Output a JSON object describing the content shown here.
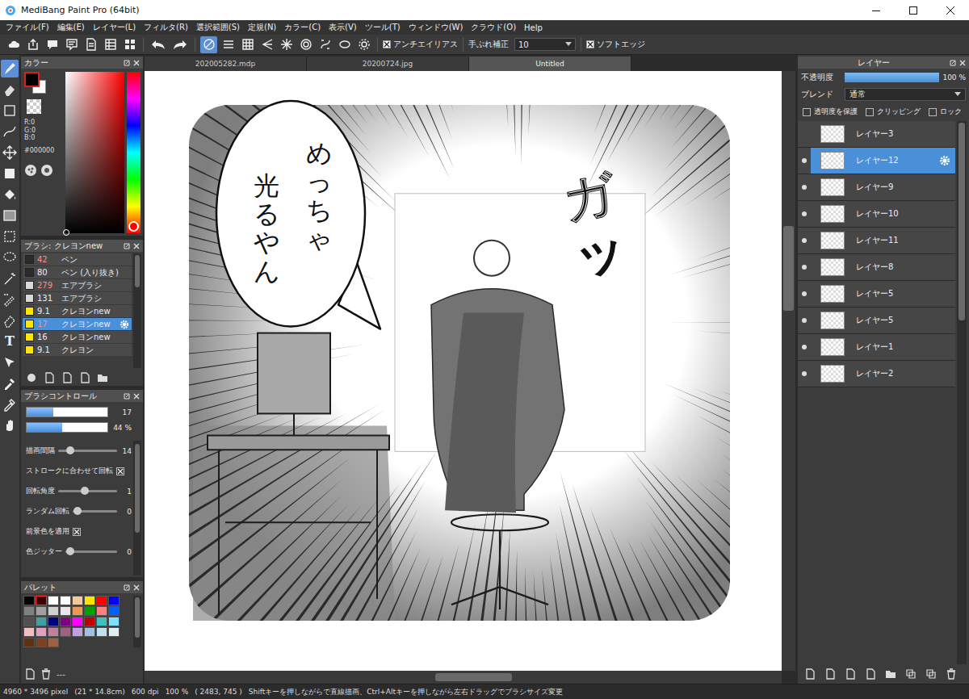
{
  "window": {
    "title": "MediBang Paint Pro (64bit)"
  },
  "menu": [
    "ファイル(F)",
    "編集(E)",
    "レイヤー(L)",
    "フィルタ(R)",
    "選択範囲(S)",
    "定規(N)",
    "カラー(C)",
    "表示(V)",
    "ツール(T)",
    "ウィンドウ(W)",
    "クラウド(O)",
    "Help"
  ],
  "toolbar": {
    "ruler_modes": [
      {
        "selected": true
      },
      {
        "selected": false
      },
      {
        "selected": false
      },
      {
        "selected": false
      },
      {
        "selected": false
      },
      {
        "selected": false
      },
      {
        "selected": false
      },
      {
        "selected": false
      },
      {
        "selected": false
      }
    ],
    "antialias": {
      "label": "アンチエイリアス",
      "checked": true
    },
    "stabilizer": {
      "label": "手ぶれ補正",
      "value": "10"
    },
    "soft_edge": {
      "label": "ソフトエッジ",
      "checked": true
    }
  },
  "tools": [
    {
      "kind": "brush",
      "selected": true
    },
    {
      "kind": "eraser",
      "selected": false
    },
    {
      "kind": "shape",
      "selected": false
    },
    {
      "kind": "curve",
      "selected": false
    },
    {
      "kind": "move",
      "selected": false
    },
    {
      "kind": "fill-rect",
      "selected": false
    },
    {
      "kind": "bucket",
      "selected": false
    },
    {
      "kind": "gradient",
      "selected": false
    },
    {
      "kind": "select",
      "selected": false
    },
    {
      "kind": "lasso",
      "selected": false
    },
    {
      "kind": "wand",
      "selected": false
    },
    {
      "kind": "select-pen",
      "selected": false
    },
    {
      "kind": "select-eraser",
      "selected": false
    },
    {
      "kind": "text",
      "glyph": "T",
      "selected": false
    },
    {
      "kind": "operation",
      "selected": false
    },
    {
      "kind": "dropper",
      "selected": false
    },
    {
      "kind": "dropper2",
      "selected": false
    },
    {
      "kind": "hand",
      "selected": false
    }
  ],
  "color_panel": {
    "title": "カラー",
    "foreground": "#000000",
    "r": "R:0",
    "g": "G:0",
    "b": "B:0",
    "hex": "#000000"
  },
  "brush_panel": {
    "title": "ブラシ: クレヨンnew",
    "items": [
      {
        "size": "42",
        "name": "ペン",
        "color": "#2b2b2b",
        "highlight": true,
        "selected": false
      },
      {
        "size": "80",
        "name": "ペン (入り抜き)",
        "color": "#2b2b2b",
        "highlight": false,
        "selected": false
      },
      {
        "size": "279",
        "name": "エアブラシ",
        "color": "#d9d9d9",
        "highlight": true,
        "selected": false
      },
      {
        "size": "131",
        "name": "エアブラシ",
        "color": "#d9d9d9",
        "highlight": false,
        "selected": false
      },
      {
        "size": "9.1",
        "name": "クレヨンnew",
        "color": "#ffe600",
        "highlight": false,
        "selected": false
      },
      {
        "size": "17",
        "name": "クレヨンnew",
        "color": "#ffe600",
        "highlight": true,
        "selected": true
      },
      {
        "size": "16",
        "name": "クレヨンnew",
        "color": "#ffe600",
        "highlight": false,
        "selected": false
      },
      {
        "size": "9.1",
        "name": "クレヨン",
        "color": "#ffe600",
        "highlight": false,
        "selected": false
      }
    ]
  },
  "brush_control": {
    "title": "ブラシコントロール",
    "size": {
      "value": "17",
      "level": 0.33
    },
    "opacity": {
      "value": "44 %",
      "level": 0.44
    },
    "settings": [
      {
        "kind": "slider",
        "label": "描画間隔",
        "level": 0.2
      },
      {
        "kind": "check",
        "label": "ストロークに合わせて回転",
        "checked": true
      },
      {
        "kind": "slider",
        "label": "回転角度",
        "level": 0.45
      },
      {
        "kind": "slider",
        "label": "ランダム回転",
        "level": 0.1
      },
      {
        "kind": "check",
        "label": "前景色を適用",
        "checked": true
      },
      {
        "kind": "slider",
        "label": "色ジッター",
        "level": 0.1
      }
    ],
    "values": [
      "14",
      "1",
      "0",
      "0"
    ]
  },
  "palette": {
    "title": "パレット",
    "footer": "---",
    "swatches": [
      {
        "color": "#000000",
        "selected": false
      },
      {
        "color": "#3a0000",
        "selected": true
      },
      {
        "color": "#ffffff",
        "selected": false
      },
      {
        "color": "#ffffff",
        "selected": false
      },
      {
        "color": "#f3c89a",
        "selected": false
      },
      {
        "color": "#ffe400",
        "selected": false
      },
      {
        "color": "#ff0000",
        "selected": false
      },
      {
        "color": "#0000ff",
        "selected": false
      },
      {
        "color": "#808080",
        "selected": false
      },
      {
        "color": "#a0a0a0",
        "selected": false
      },
      {
        "color": "#d0d0d0",
        "selected": false
      },
      {
        "color": "#e8e8e8",
        "selected": false
      },
      {
        "color": "#e89a5a",
        "selected": false
      },
      {
        "color": "#00a000",
        "selected": false
      },
      {
        "color": "#ff8080",
        "selected": false
      },
      {
        "color": "#0060ff",
        "selected": false
      },
      {
        "color": "#505050",
        "selected": false
      },
      {
        "color": "#40a0a0",
        "selected": false
      },
      {
        "color": "#000080",
        "selected": false
      },
      {
        "color": "#800080",
        "selected": false
      },
      {
        "color": "#ff00ff",
        "selected": false
      },
      {
        "color": "#c00000",
        "selected": false
      },
      {
        "color": "#40c0c0",
        "selected": false
      },
      {
        "color": "#80e0ff",
        "selected": false
      },
      {
        "color": "#f0c0c0",
        "selected": false
      },
      {
        "color": "#e0a0c0",
        "selected": false
      },
      {
        "color": "#c080a0",
        "selected": false
      },
      {
        "color": "#a06080",
        "selected": false
      },
      {
        "color": "#c0a0e0",
        "selected": false
      },
      {
        "color": "#a0c0e0",
        "selected": false
      },
      {
        "color": "#c0e0f0",
        "selected": false
      },
      {
        "color": "#e0f0f0",
        "selected": false
      },
      {
        "color": "#603010",
        "selected": false
      },
      {
        "color": "#804020",
        "selected": false
      },
      {
        "color": "#a06040",
        "selected": false
      }
    ]
  },
  "tabs": [
    {
      "label": "202005282.mdp",
      "selected": false
    },
    {
      "label": "20200724.jpg",
      "selected": false
    },
    {
      "label": "Untitled",
      "selected": true
    }
  ],
  "canvas": {
    "bubble": [
      "めっちゃ",
      "光るやん"
    ],
    "sfx": "ガッ"
  },
  "layers_panel": {
    "title": "レイヤー",
    "opacity": {
      "label": "不透明度",
      "value": "100 %",
      "level": 1
    },
    "blend": {
      "label": "ブレンド",
      "value": "通常"
    },
    "options": [
      {
        "label": "透明度を保護",
        "checked": false
      },
      {
        "label": "クリッピング",
        "checked": false
      },
      {
        "label": "ロック",
        "checked": false
      }
    ],
    "layers": [
      {
        "name": "レイヤー3",
        "visible": false,
        "selected": false
      },
      {
        "name": "レイヤー12",
        "visible": true,
        "selected": true
      },
      {
        "name": "レイヤー9",
        "visible": true,
        "selected": false
      },
      {
        "name": "レイヤー10",
        "visible": true,
        "selected": false
      },
      {
        "name": "レイヤー11",
        "visible": true,
        "selected": false
      },
      {
        "name": "レイヤー8",
        "visible": true,
        "selected": false
      },
      {
        "name": "レイヤー5",
        "visible": true,
        "selected": false
      },
      {
        "name": "レイヤー5",
        "visible": true,
        "selected": false
      },
      {
        "name": "レイヤー1",
        "visible": true,
        "selected": false
      },
      {
        "name": "レイヤー2",
        "visible": true,
        "selected": false
      }
    ]
  },
  "status_bar": {
    "size": "4960 * 3496 pixel",
    "cm": "(21 * 14.8cm)",
    "dpi": "600 dpi",
    "zoom": "100 %",
    "position": "( 2483, 745 )",
    "hint": "Shiftキーを押しながらで直線描画、Ctrl+Altキーを押しながら左右ドラッグでブラシサイズ変更"
  }
}
